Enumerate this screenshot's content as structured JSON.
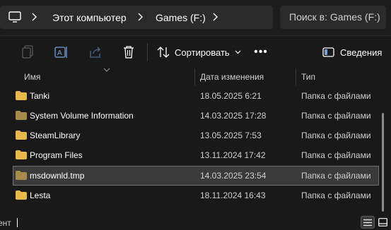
{
  "address_bar": {
    "breadcrumbs": [
      "Этот компьютер",
      "Games (F:)"
    ],
    "search_placeholder": "Поиск в: Games (F:)"
  },
  "toolbar": {
    "sort_label": "Сортировать",
    "more_label": "•••",
    "details_label": "Сведения",
    "icons": [
      "copy-icon",
      "rename-icon",
      "share-icon",
      "delete-icon",
      "sort-icon",
      "details-pane-icon"
    ]
  },
  "columns": {
    "name": "Имя",
    "date": "Дата изменения",
    "type": "Тип"
  },
  "files": [
    {
      "name": "Tanki",
      "date": "18.05.2025 6:21",
      "type": "Папка с файлами",
      "selected": false
    },
    {
      "name": "System Volume Information",
      "date": "14.03.2025 17:28",
      "type": "Папка с файлами",
      "selected": false
    },
    {
      "name": "SteamLibrary",
      "date": "13.05.2025 7:53",
      "type": "Папка с файлами",
      "selected": false
    },
    {
      "name": "Program Files",
      "date": "13.11.2024 17:42",
      "type": "Папка с файлами",
      "selected": false
    },
    {
      "name": "msdownld.tmp",
      "date": "14.03.2025 23:54",
      "type": "Папка с файлами",
      "selected": true
    },
    {
      "name": "Lesta",
      "date": "18.11.2024 16:43",
      "type": "Папка с файлами",
      "selected": false
    }
  ],
  "status": {
    "text": "ент"
  },
  "colors": {
    "folder": "#e8b84a",
    "folder_dim": "#a88a4a",
    "selection": "#3a3a3a",
    "background": "#191919"
  }
}
